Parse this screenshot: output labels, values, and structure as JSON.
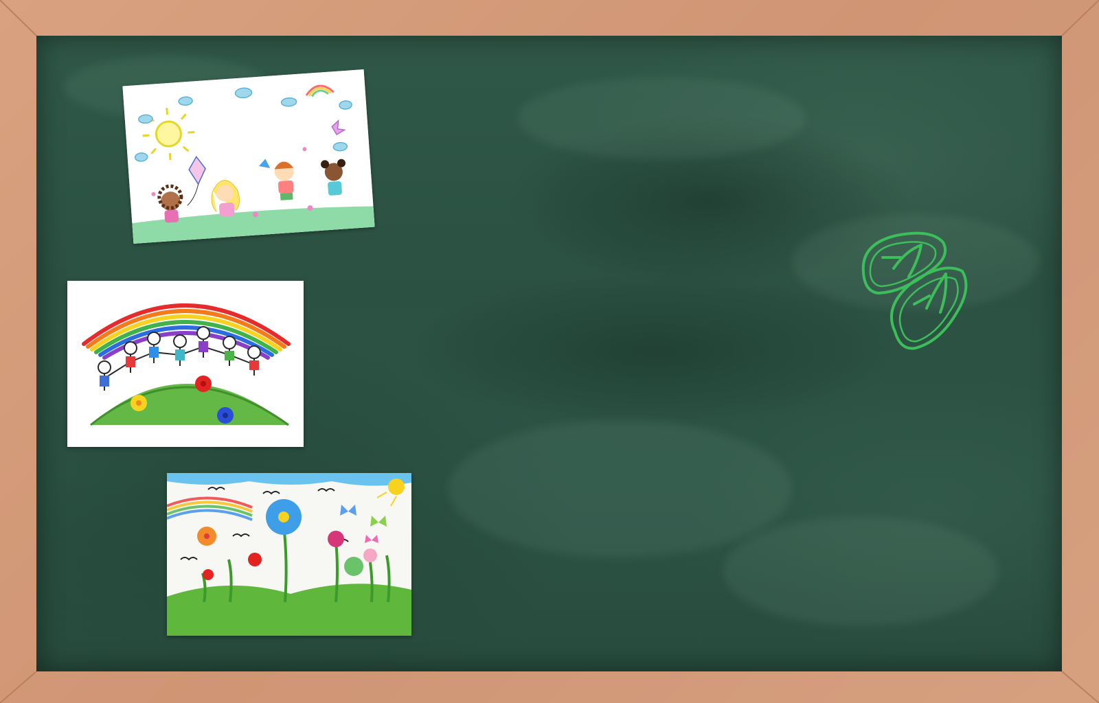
{
  "board": {
    "frame_color": "#d49c7b",
    "surface_color": "#2d5545"
  },
  "stickers": [
    {
      "name": "kids-playing-drawing",
      "icon": "children-kite-sun-icon"
    },
    {
      "name": "rainbow-children-drawing",
      "icon": "rainbow-children-hill-icon"
    },
    {
      "name": "flowers-garden-drawing",
      "icon": "flowers-butterflies-icon"
    },
    {
      "name": "flip-flops-doodle",
      "icon": "sandals-icon",
      "color": "#3dbe5a"
    }
  ]
}
